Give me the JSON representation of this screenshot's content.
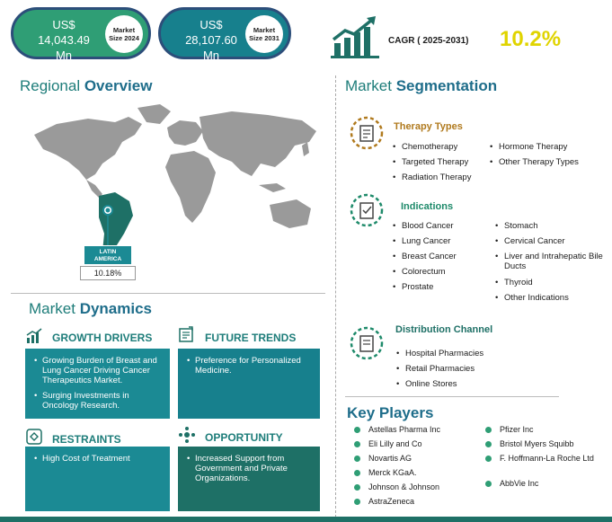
{
  "stats": {
    "market_2024": {
      "value": "US$\n14,043.49\nMn",
      "badge": "Market\nSize 2024"
    },
    "market_2031": {
      "value": "US$\n28,107.60\nMn",
      "badge": "Market\nSize 2031"
    },
    "cagr_label": "CAGR ( 2025-2031)",
    "cagr_value": "10.2%"
  },
  "regional": {
    "title_plain": "Regional ",
    "title_bold": "Overview",
    "region_name": "LATIN\nAMERICA",
    "region_value": "10.18%"
  },
  "dynamics": {
    "title_plain": "Market ",
    "title_bold": "Dynamics",
    "growth": {
      "title": "GROWTH DRIVERS",
      "items": [
        "Growing Burden of Breast and Lung Cancer Driving Cancer Therapeutics Market.",
        "Surging Investments in Oncology Research."
      ]
    },
    "trends": {
      "title": "FUTURE TRENDS",
      "items": [
        "Preference for Personalized Medicine."
      ]
    },
    "restraints": {
      "title": "RESTRAINTS",
      "items": [
        "High Cost of Treatment"
      ]
    },
    "opportunity": {
      "title": "OPPORTUNITY",
      "items": [
        "Increased Support from Government and Private Organizations."
      ]
    }
  },
  "segmentation": {
    "title_plain": "Market ",
    "title_bold": "Segmentation",
    "therapy": {
      "title": "Therapy Types",
      "col1": [
        "Chemotherapy",
        "Targeted Therapy",
        "Radiation Therapy"
      ],
      "col2": [
        "Hormone Therapy",
        "Other Therapy Types"
      ]
    },
    "indications": {
      "title": "Indications",
      "col1": [
        "Blood Cancer",
        "Lung Cancer",
        "Breast Cancer",
        "Colorectum",
        "Prostate"
      ],
      "col2": [
        "Stomach",
        "Cervical Cancer",
        "Liver and Intrahepatic Bile Ducts",
        "Thyroid",
        "Other Indications"
      ]
    },
    "distribution": {
      "title": "Distribution Channel",
      "items": [
        "Hospital Pharmacies",
        "Retail Pharmacies",
        "Online Stores"
      ]
    }
  },
  "key_players": {
    "title": "Key Players",
    "col1": [
      "Astellas Pharma Inc",
      "Eli Lilly and Co",
      "Novartis AG",
      "Merck KGaA.",
      "Johnson & Johnson",
      "AstraZeneca"
    ],
    "col2": [
      "Pfizer Inc",
      "Bristol Myers Squibb",
      "F. Hoffmann-La Roche Ltd",
      "AbbVie Inc"
    ]
  },
  "colors": {
    "teal_dark": "#1e7066",
    "teal": "#1b8a94",
    "green": "#2f9e75",
    "cagr": "#e0d400",
    "therapy_accent": "#b07a1e",
    "indications_accent": "#1e8a6a"
  }
}
